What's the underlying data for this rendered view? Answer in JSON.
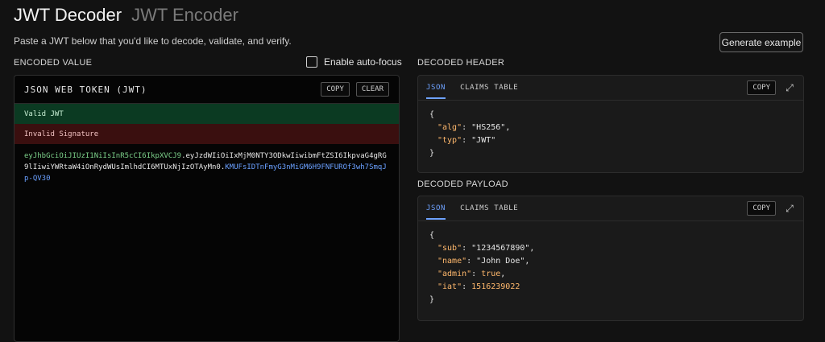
{
  "header": {
    "decoder_tab": "JWT Decoder",
    "encoder_tab": "JWT Encoder",
    "subtitle": "Paste a JWT below that you'd like to decode, validate, and verify.",
    "generate_example": "Generate example"
  },
  "encoded": {
    "label": "ENCODED VALUE",
    "auto_focus_label": "Enable auto-focus",
    "panel_title": "JSON WEB TOKEN (JWT)",
    "copy": "COPY",
    "clear": "CLEAR",
    "valid_text": "Valid JWT",
    "invalid_text": "Invalid Signature",
    "token": {
      "header_part": "eyJhbGciOiJIUzI1NiIsInR5cCI6IkpXVCJ9",
      "payload_part": "eyJzdWIiOiIxMjM0NTY3ODkwIiwibmFtZSI6IkpvaG4gRG9lIiwiYWRtaW4iOnRydWUsImlhdCI6MTUxNjIzOTAyMn0",
      "signature_part": "KMUFsIDTnFmyG3nMiGM6H9FNFUROf3wh7SmqJp-QV30"
    }
  },
  "decoded_header": {
    "label": "DECODED HEADER",
    "tab_json": "JSON",
    "tab_claims": "CLAIMS TABLE",
    "copy": "COPY",
    "json_lines": {
      "alg_key": "\"alg\"",
      "alg_val": "\"HS256\"",
      "typ_key": "\"typ\"",
      "typ_val": "\"JWT\""
    }
  },
  "decoded_payload": {
    "label": "DECODED PAYLOAD",
    "tab_json": "JSON",
    "tab_claims": "CLAIMS TABLE",
    "copy": "COPY",
    "json_lines": {
      "sub_key": "\"sub\"",
      "sub_val": "\"1234567890\"",
      "name_key": "\"name\"",
      "name_val": "\"John Doe\"",
      "admin_key": "\"admin\"",
      "admin_val": "true",
      "iat_key": "\"iat\"",
      "iat_val": "1516239022"
    }
  },
  "colors": {
    "background": "#121212",
    "accent_blue": "#6ea2ff",
    "json_key": "#ffb86c",
    "valid_bg": "#0b3a22",
    "invalid_bg": "#3a0f0f",
    "token_header": "#7cd08a",
    "token_signature": "#6aa0ff"
  }
}
